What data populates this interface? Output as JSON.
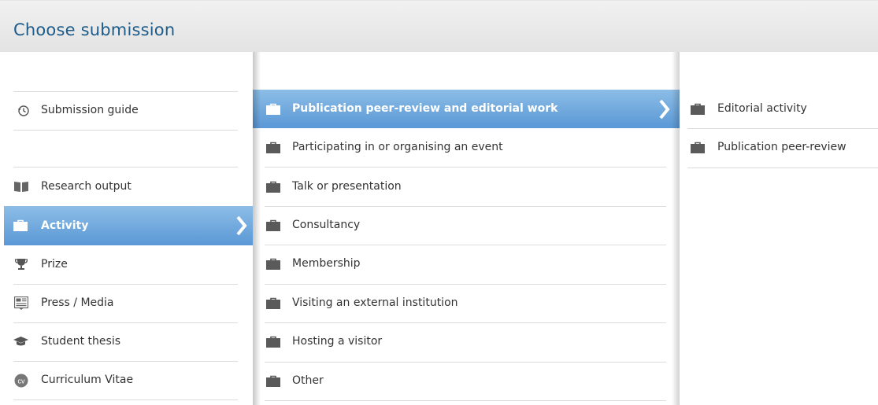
{
  "dialog": {
    "title": "Choose submission"
  },
  "column1": {
    "items": [
      {
        "label": "Submission guide",
        "icon": "history-icon"
      },
      {
        "label": "Research output",
        "icon": "book-icon"
      },
      {
        "label": "Activity",
        "icon": "briefcase-icon",
        "selected": true
      },
      {
        "label": "Prize",
        "icon": "trophy-icon"
      },
      {
        "label": "Press / Media",
        "icon": "newspaper-icon"
      },
      {
        "label": "Student thesis",
        "icon": "graduation-cap-icon"
      },
      {
        "label": "Curriculum Vitae",
        "icon": "cv-icon"
      }
    ]
  },
  "column2": {
    "items": [
      {
        "label": "Publication peer-review and editorial work",
        "icon": "briefcase-icon",
        "selected": true
      },
      {
        "label": "Participating in or organising an event",
        "icon": "briefcase-icon"
      },
      {
        "label": "Talk or presentation",
        "icon": "briefcase-icon"
      },
      {
        "label": "Consultancy",
        "icon": "briefcase-icon"
      },
      {
        "label": "Membership",
        "icon": "briefcase-icon"
      },
      {
        "label": "Visiting an external institution",
        "icon": "briefcase-icon"
      },
      {
        "label": "Hosting a visitor",
        "icon": "briefcase-icon"
      },
      {
        "label": "Other",
        "icon": "briefcase-icon"
      }
    ]
  },
  "column3": {
    "items": [
      {
        "label": "Editorial activity",
        "icon": "briefcase-icon"
      },
      {
        "label": "Publication peer-review",
        "icon": "briefcase-icon"
      }
    ]
  },
  "colors": {
    "title": "#1d5c8a",
    "selection": "#5b98d6",
    "icon": "#5a5a5a"
  }
}
